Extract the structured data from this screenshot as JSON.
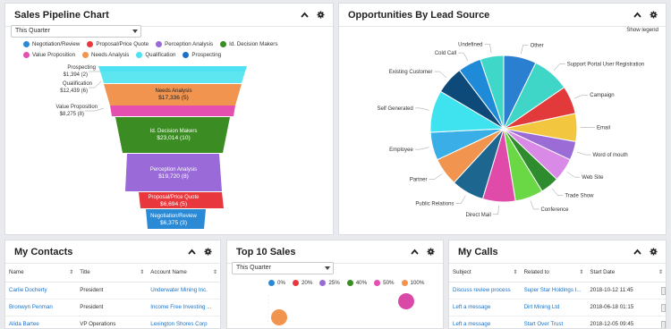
{
  "pipeline": {
    "title": "Sales Pipeline Chart",
    "filter": "This Quarter",
    "legend": [
      {
        "label": "Negotiation/Review",
        "color": "#2b8ad6"
      },
      {
        "label": "Proposal/Price Quote",
        "color": "#e8383d"
      },
      {
        "label": "Perception Analysis",
        "color": "#9a6ad8"
      },
      {
        "label": "Id. Decision Makers",
        "color": "#3b8c22"
      },
      {
        "label": "Value Proposition",
        "color": "#e44fb0"
      },
      {
        "label": "Needs Analysis",
        "color": "#f0944f"
      },
      {
        "label": "Qualification",
        "color": "#4ee2f2"
      },
      {
        "label": "Prospecting",
        "color": "#1d6fcc"
      }
    ],
    "side_labels": [
      {
        "name": "Prospecting",
        "value": "$1,394 (2)"
      },
      {
        "name": "Qualification",
        "value": "$12,439 (6)"
      },
      {
        "name": "Value Proposition",
        "value": "$8,275 (8)"
      }
    ],
    "inner_labels": [
      {
        "name": "Needs Analysis",
        "value": "$17,336 (5)"
      },
      {
        "name": "Id. Decision Makers",
        "value": "$23,014 (10)"
      },
      {
        "name": "Perception Analysis",
        "value": "$19,720 (8)"
      },
      {
        "name": "Proposal/Price Quote",
        "value": "$6,694 (5)"
      },
      {
        "name": "Negotiation/Review",
        "value": "$6,375 (3)"
      }
    ]
  },
  "leadsource": {
    "title": "Opportunities By Lead Source",
    "show_legend": "Show legend",
    "labels": [
      "Other",
      "Support Portal User Registration",
      "Campaign",
      "Email",
      "Word of mouth",
      "Web Site",
      "Trade Show",
      "Conference",
      "Direct Mail",
      "Public Relations",
      "Partner",
      "Employee",
      "Self Generated",
      "Existing Customer",
      "Cold Call",
      "Undefined"
    ],
    "colors": [
      "#2b7fd1",
      "#3fd5c7",
      "#e23a3a",
      "#f3c63f",
      "#9b6bd6",
      "#d98ae6",
      "#2e8b2e",
      "#6ad844",
      "#e04aa8",
      "#1d6690",
      "#f0944f",
      "#3aaee6",
      "#3fe2ef",
      "#0d4a7a",
      "#1f8bd8",
      "#3fd8c8"
    ],
    "values": [
      7,
      8,
      6,
      6,
      4,
      5,
      4,
      6,
      7,
      7,
      6,
      6,
      9,
      6,
      5,
      5
    ]
  },
  "contacts": {
    "title": "My Contacts",
    "columns": [
      "Name",
      "Title",
      "Account Name"
    ],
    "rows": [
      [
        "Carlie Docherty",
        "President",
        "Underwater Mining Inc."
      ],
      [
        "Bronwyn Penman",
        "President",
        "Income Free Investing ..."
      ],
      [
        "Alida Bartee",
        "VP Operations",
        "Lexington Shores Corp"
      ]
    ]
  },
  "topsales": {
    "title": "Top 10 Sales",
    "filter": "This Quarter",
    "legend": [
      {
        "label": "0%",
        "color": "#2b8ad6"
      },
      {
        "label": "20%",
        "color": "#e8383d"
      },
      {
        "label": "25%",
        "color": "#9a6ad8"
      },
      {
        "label": "40%",
        "color": "#3b8c22"
      },
      {
        "label": "50%",
        "color": "#e44fb0"
      },
      {
        "label": "100%",
        "color": "#f0944f"
      }
    ]
  },
  "calls": {
    "title": "My Calls",
    "columns": [
      "Subject",
      "Related to",
      "Start Date"
    ],
    "rows": [
      [
        "Discuss review process",
        "Super Star Holdings I...",
        "2018-10-12 11:45"
      ],
      [
        "Left a message",
        "Dirt Mining Ltd",
        "2018-06-18 01:15"
      ],
      [
        "Left a message",
        "Start Over Trust",
        "2018-12-05 09:45"
      ]
    ]
  }
}
